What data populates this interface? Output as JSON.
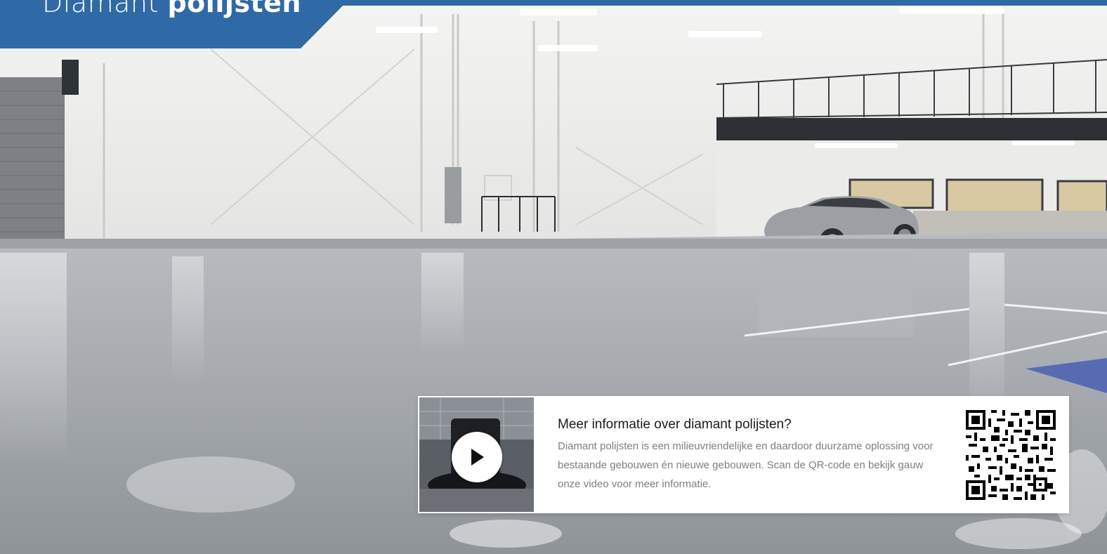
{
  "banner": {
    "title_regular": "Diamant",
    "title_bold": "polijsten",
    "color": "#2f6aa6"
  },
  "info_card": {
    "heading": "Meer informatie over diamant polijsten?",
    "body": "Diamant polijsten is een milieuvriendelijke en daardoor duurzame oplossing voor bestaande gebouwen én nieuwe gebouwen. Scan de QR-code en bekijk gauw onze video voor meer informatie.",
    "video_icon": "play-icon",
    "qr_icon": "qr-code-icon"
  },
  "colors": {
    "accent": "#2f6aa6",
    "card_text": "#7a8087",
    "heading_text": "#1a1a1a"
  }
}
